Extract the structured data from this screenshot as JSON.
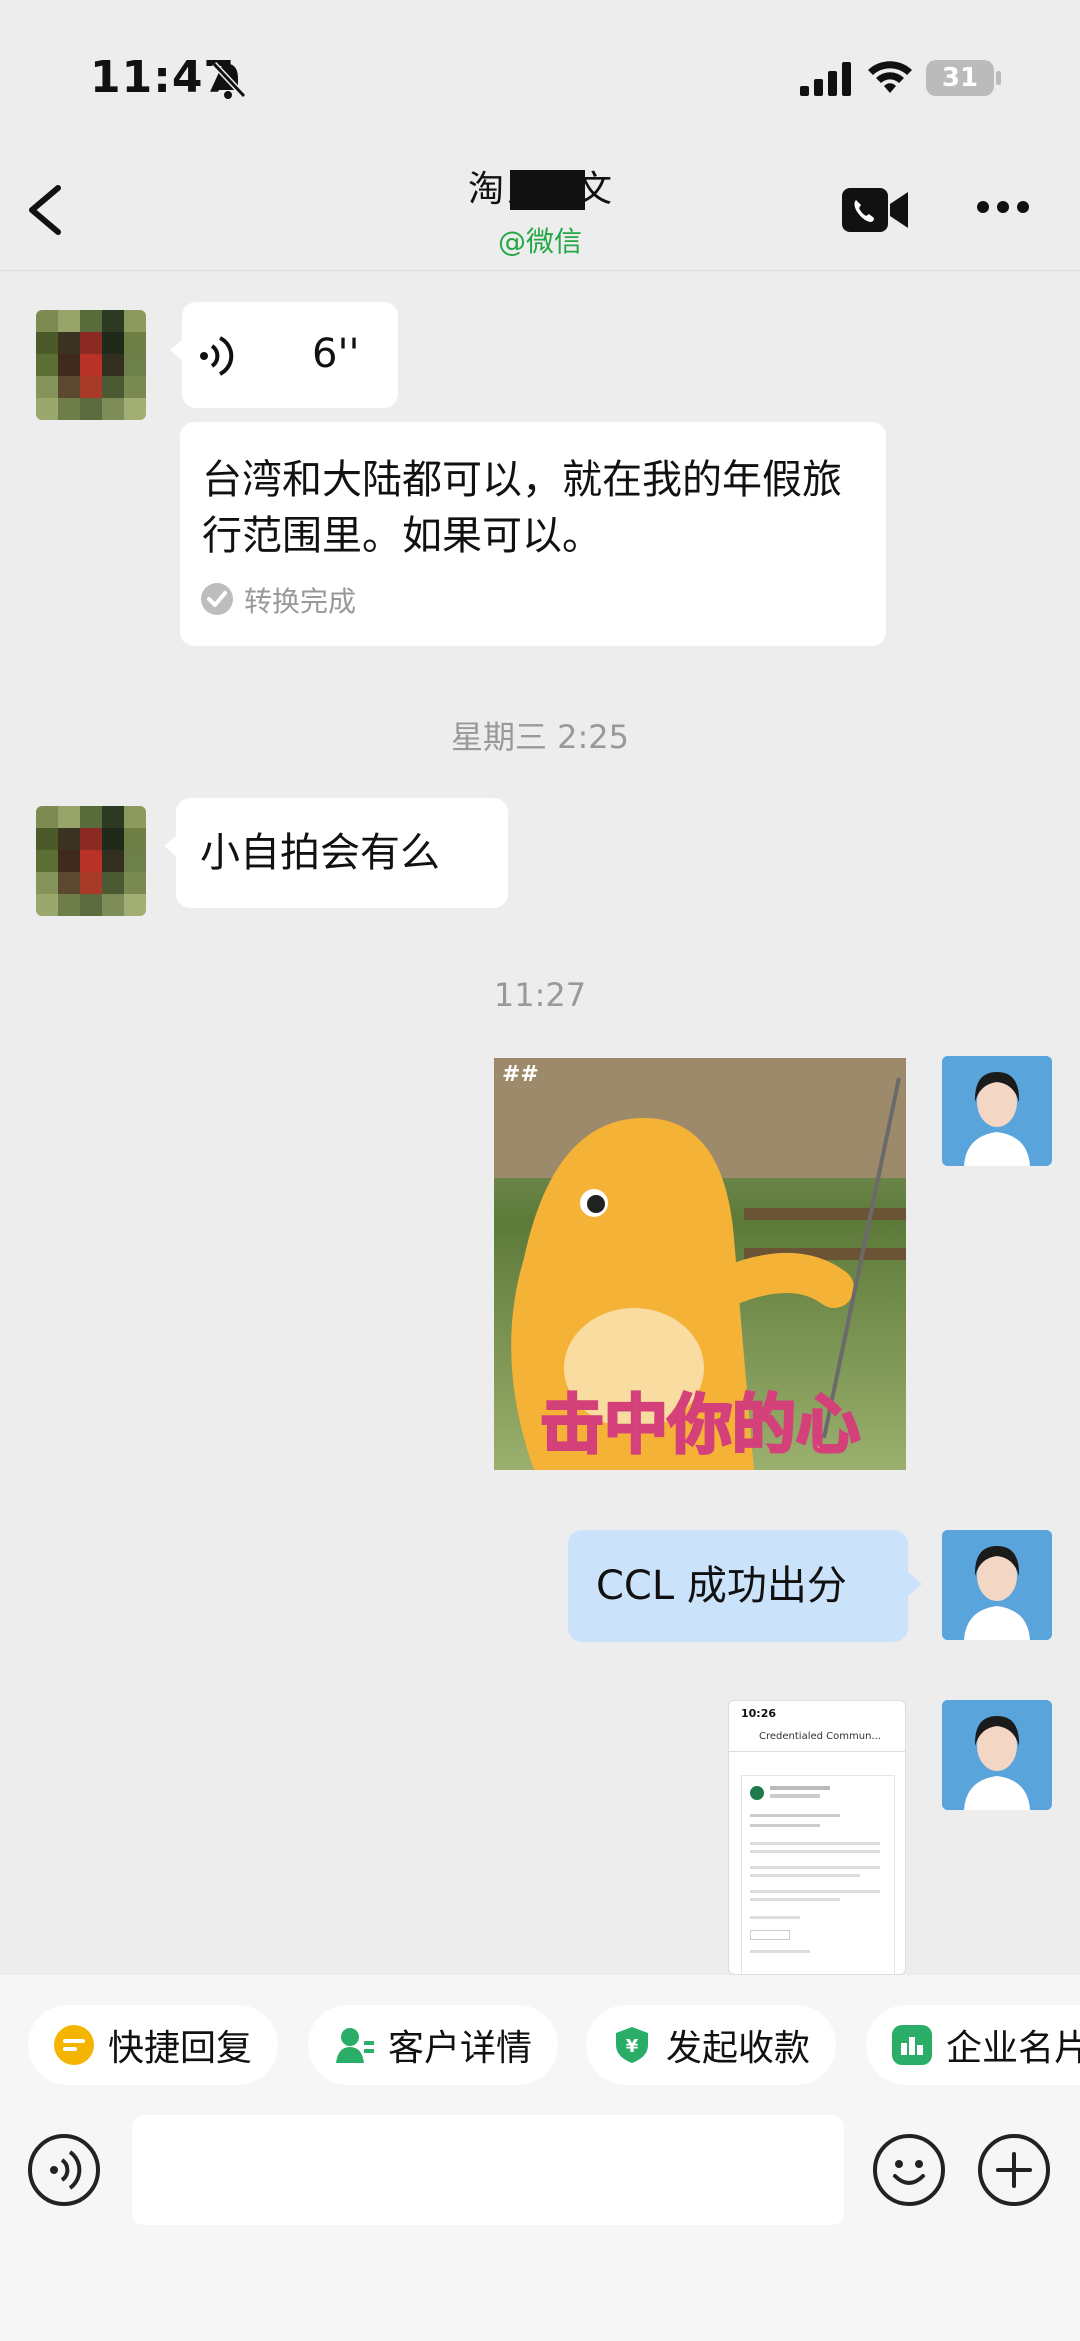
{
  "status_bar": {
    "time": "11:47",
    "battery": "31"
  },
  "nav": {
    "title": "淘氏・文",
    "subtitle": "@微信"
  },
  "messages": {
    "voice_duration": "6''",
    "voice_transcript": "台湾和大陆都可以，就在我的年假旅行范围里。如果可以。",
    "transcript_status": "转换完成",
    "timestamp_1": "星期三 2:25",
    "text_1": "小自拍会有么",
    "timestamp_2": "11:27",
    "sticker_caption": "击中你的心",
    "sticker_tag": "##",
    "text_2": "CCL 成功出分",
    "doc_thumb_time": "10:26",
    "doc_thumb_title": "Credentialed Commun..."
  },
  "toolbar": {
    "chips": [
      {
        "label": "快捷回复",
        "color": "#f5b400"
      },
      {
        "label": "客户详情",
        "color": "#2aae67"
      },
      {
        "label": "发起收款",
        "color": "#2aae67"
      },
      {
        "label": "企业名片",
        "color": "#2aae67"
      }
    ]
  },
  "colors": {
    "background": "#ededed",
    "sent_bubble": "#cbe3fa",
    "accent_green": "#22a845"
  }
}
